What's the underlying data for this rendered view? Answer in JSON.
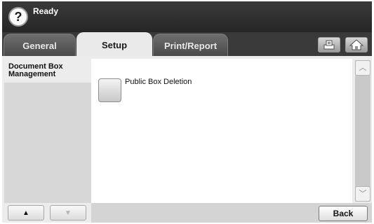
{
  "status": {
    "help_label": "?",
    "text": "Ready"
  },
  "tabs": [
    {
      "label": "General",
      "active": false
    },
    {
      "label": "Setup",
      "active": true
    },
    {
      "label": "Print/Report",
      "active": false
    }
  ],
  "top_buttons": {
    "tray_icon": "tray-icon",
    "home_icon": "home-icon"
  },
  "sidebar": {
    "header": "Document Box Management",
    "up_arrow": "▲",
    "down_arrow": "▼"
  },
  "main": {
    "items": [
      {
        "label": "Public Box Deletion"
      }
    ]
  },
  "scroll": {
    "up": "︿",
    "down": "﹀"
  },
  "footer": {
    "back_label": "Back"
  },
  "colors": {
    "background_dark": "#2b2b2b",
    "panel": "#ececec",
    "white": "#ffffff"
  }
}
